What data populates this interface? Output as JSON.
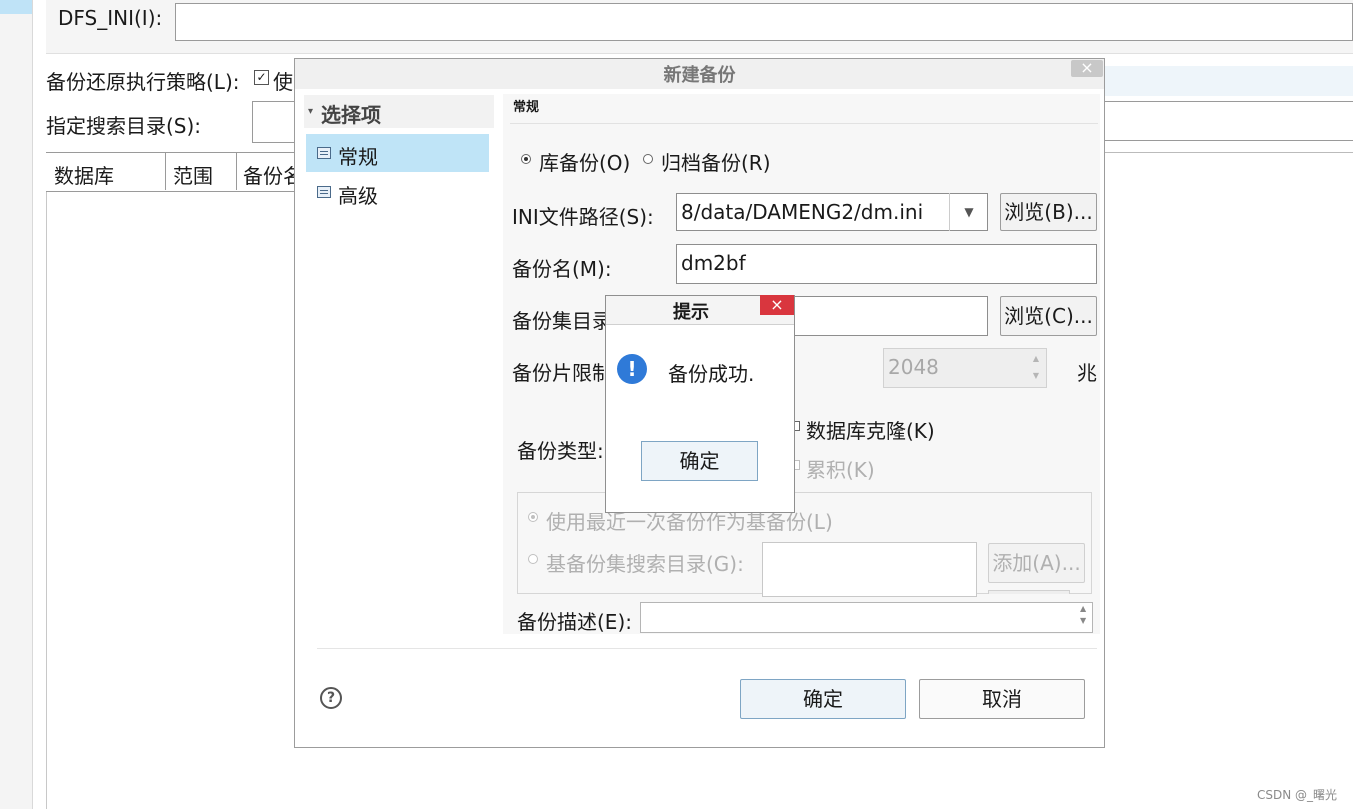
{
  "background": {
    "dfs_ini_label": "DFS_INI(I):",
    "strategy_label": "备份还原执行策略(L):",
    "strategy_checked": true,
    "strategy_rest": "使",
    "search_dir_label": "指定搜索目录(S):",
    "table_headers": [
      "数据库",
      "范围",
      "备份名"
    ]
  },
  "dialog": {
    "title": "新建备份",
    "close": "×",
    "nav": {
      "header": "选择项",
      "items": [
        {
          "label": "常规",
          "selected": true
        },
        {
          "label": "高级",
          "selected": false
        }
      ]
    },
    "section_title": "常规",
    "backup_kind": {
      "options": [
        {
          "label": "库备份(O)",
          "selected": true
        },
        {
          "label": "归档备份(R)",
          "selected": false
        }
      ]
    },
    "ini_path": {
      "label": "INI文件路径(S):",
      "value": "8/data/DAMENG2/dm.ini",
      "browse": "浏览(B)..."
    },
    "backup_name": {
      "label": "备份名(M):",
      "value": "dm2bf"
    },
    "backup_set_dir": {
      "label": "备份集目录",
      "value": "",
      "browse": "浏览(C)..."
    },
    "piece_limit": {
      "label": "备份片限制",
      "value": "2048",
      "unit": "兆"
    },
    "backup_type": {
      "label": "备份类型:",
      "clone_label": "数据库克隆(K)",
      "cumulative_label": "累积(K)"
    },
    "incremental": {
      "use_recent_label": "使用最近一次备份作为基备份(L)",
      "base_dir_label": "基备份集搜索目录(G):",
      "add_button": "添加(A)..."
    },
    "description": {
      "label": "备份描述(E):",
      "value": ""
    },
    "help": "?",
    "ok": "确定",
    "cancel": "取消"
  },
  "message_box": {
    "title": "提示",
    "close": "×",
    "icon": "!",
    "text": "备份成功.",
    "ok": "确定"
  },
  "watermark": "CSDN @_曙光"
}
